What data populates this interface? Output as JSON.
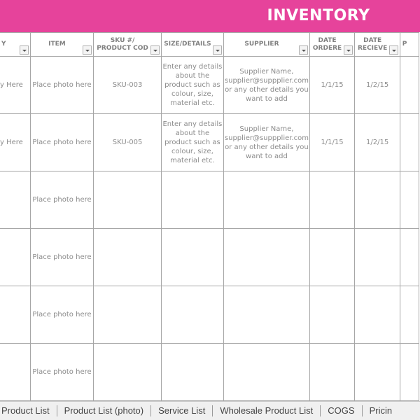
{
  "header": {
    "title": "INVENTORY",
    "accent": "#e6439b"
  },
  "columns": [
    {
      "label": "Y"
    },
    {
      "label": "ITEM"
    },
    {
      "label": "SKU #/\nPRODUCT COD"
    },
    {
      "label": "SIZE/DETAILS"
    },
    {
      "label": "SUPPLIER"
    },
    {
      "label": "DATE\nORDERE"
    },
    {
      "label": "DATE\nRECIEVE"
    },
    {
      "label": "P"
    }
  ],
  "rows": [
    {
      "qty": "y Here",
      "item": "Place photo here",
      "sku": "SKU-003",
      "details": "Enter any details about the product such as colour, size, material etc.",
      "supplier": "Supplier Name, supplier@suppplier.com or any other details you want to add",
      "ordered": "1/1/15",
      "received": "1/2/15",
      "p": ""
    },
    {
      "qty": "y Here",
      "item": "Place photo here",
      "sku": "SKU-005",
      "details": "Enter any details about the product such as colour, size, material etc.",
      "supplier": "Supplier Name, supplier@suppplier.com or any other details you want to add",
      "ordered": "1/1/15",
      "received": "1/2/15",
      "p": ""
    },
    {
      "qty": "",
      "item": "Place photo here",
      "sku": "",
      "details": "",
      "supplier": "",
      "ordered": "",
      "received": "",
      "p": ""
    },
    {
      "qty": "",
      "item": "Place photo here",
      "sku": "",
      "details": "",
      "supplier": "",
      "ordered": "",
      "received": "",
      "p": ""
    },
    {
      "qty": "",
      "item": "Place photo here",
      "sku": "",
      "details": "",
      "supplier": "",
      "ordered": "",
      "received": "",
      "p": ""
    },
    {
      "qty": "",
      "item": "Place photo here",
      "sku": "",
      "details": "",
      "supplier": "",
      "ordered": "",
      "received": "",
      "p": ""
    }
  ],
  "sheet_tabs": [
    "Product List",
    "Product List (photo)",
    "Service List",
    "Wholesale Product List",
    "COGS",
    "Pricin"
  ]
}
